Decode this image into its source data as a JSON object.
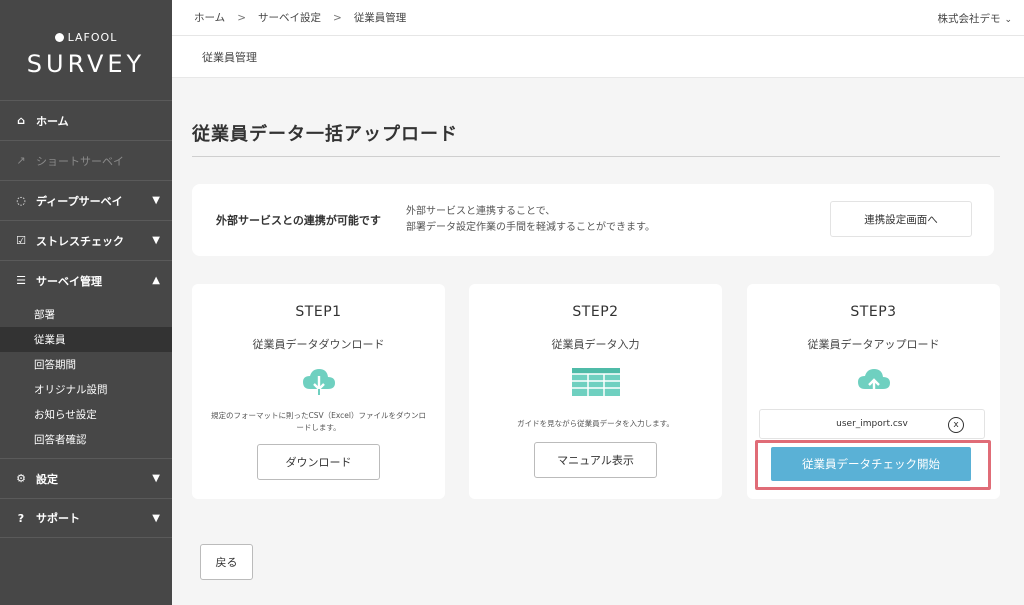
{
  "brand": {
    "small": "LAFOOL",
    "big": "SURVEY"
  },
  "sidebar": {
    "items": [
      {
        "label": "ホーム",
        "icon": "home-icon"
      },
      {
        "label": "ショートサーベイ",
        "icon": "trend-icon"
      },
      {
        "label": "ディープサーベイ",
        "icon": "loading-icon"
      },
      {
        "label": "ストレスチェック",
        "icon": "checkbox-icon"
      },
      {
        "label": "サーベイ管理",
        "icon": "sliders-icon"
      },
      {
        "label": "設定",
        "icon": "gear-icon"
      },
      {
        "label": "サポート",
        "icon": "question-icon"
      }
    ],
    "sub_items": [
      "部署",
      "従業員",
      "回答期間",
      "オリジナル設問",
      "お知らせ設定",
      "回答者確認"
    ],
    "active_sub": "従業員"
  },
  "breadcrumb": [
    "ホーム",
    "サーベイ設定",
    "従業員管理"
  ],
  "company": "株式会社デモ",
  "subheader": "従業員管理",
  "page": {
    "title": "従業員データ一括アップロード",
    "integration": {
      "lead": "外部サービスとの連携が可能です",
      "desc_line1": "外部サービスと連携することで、",
      "desc_line2": "部署データ設定作業の手間を軽減することができます。",
      "button": "連携設定画面へ"
    },
    "steps": [
      {
        "step": "STEP1",
        "title": "従業員データダウンロード",
        "note": "規定のフォーマットに則ったCSV（Excel）ファイルをダウンロードします。",
        "button": "ダウンロード"
      },
      {
        "step": "STEP2",
        "title": "従業員データ入力",
        "note": "ガイドを見ながら従業員データを入力します。",
        "button": "マニュアル表示"
      },
      {
        "step": "STEP3",
        "title": "従業員データアップロード",
        "file": "user_import.csv",
        "file_remove": "x",
        "button": "従業員データチェック開始"
      }
    ],
    "back_button": "戻る"
  },
  "colors": {
    "sidebar": "#474747",
    "accent": "#5ab1d6",
    "highlight": "#e06c77",
    "icon": "#6fd0c0"
  }
}
